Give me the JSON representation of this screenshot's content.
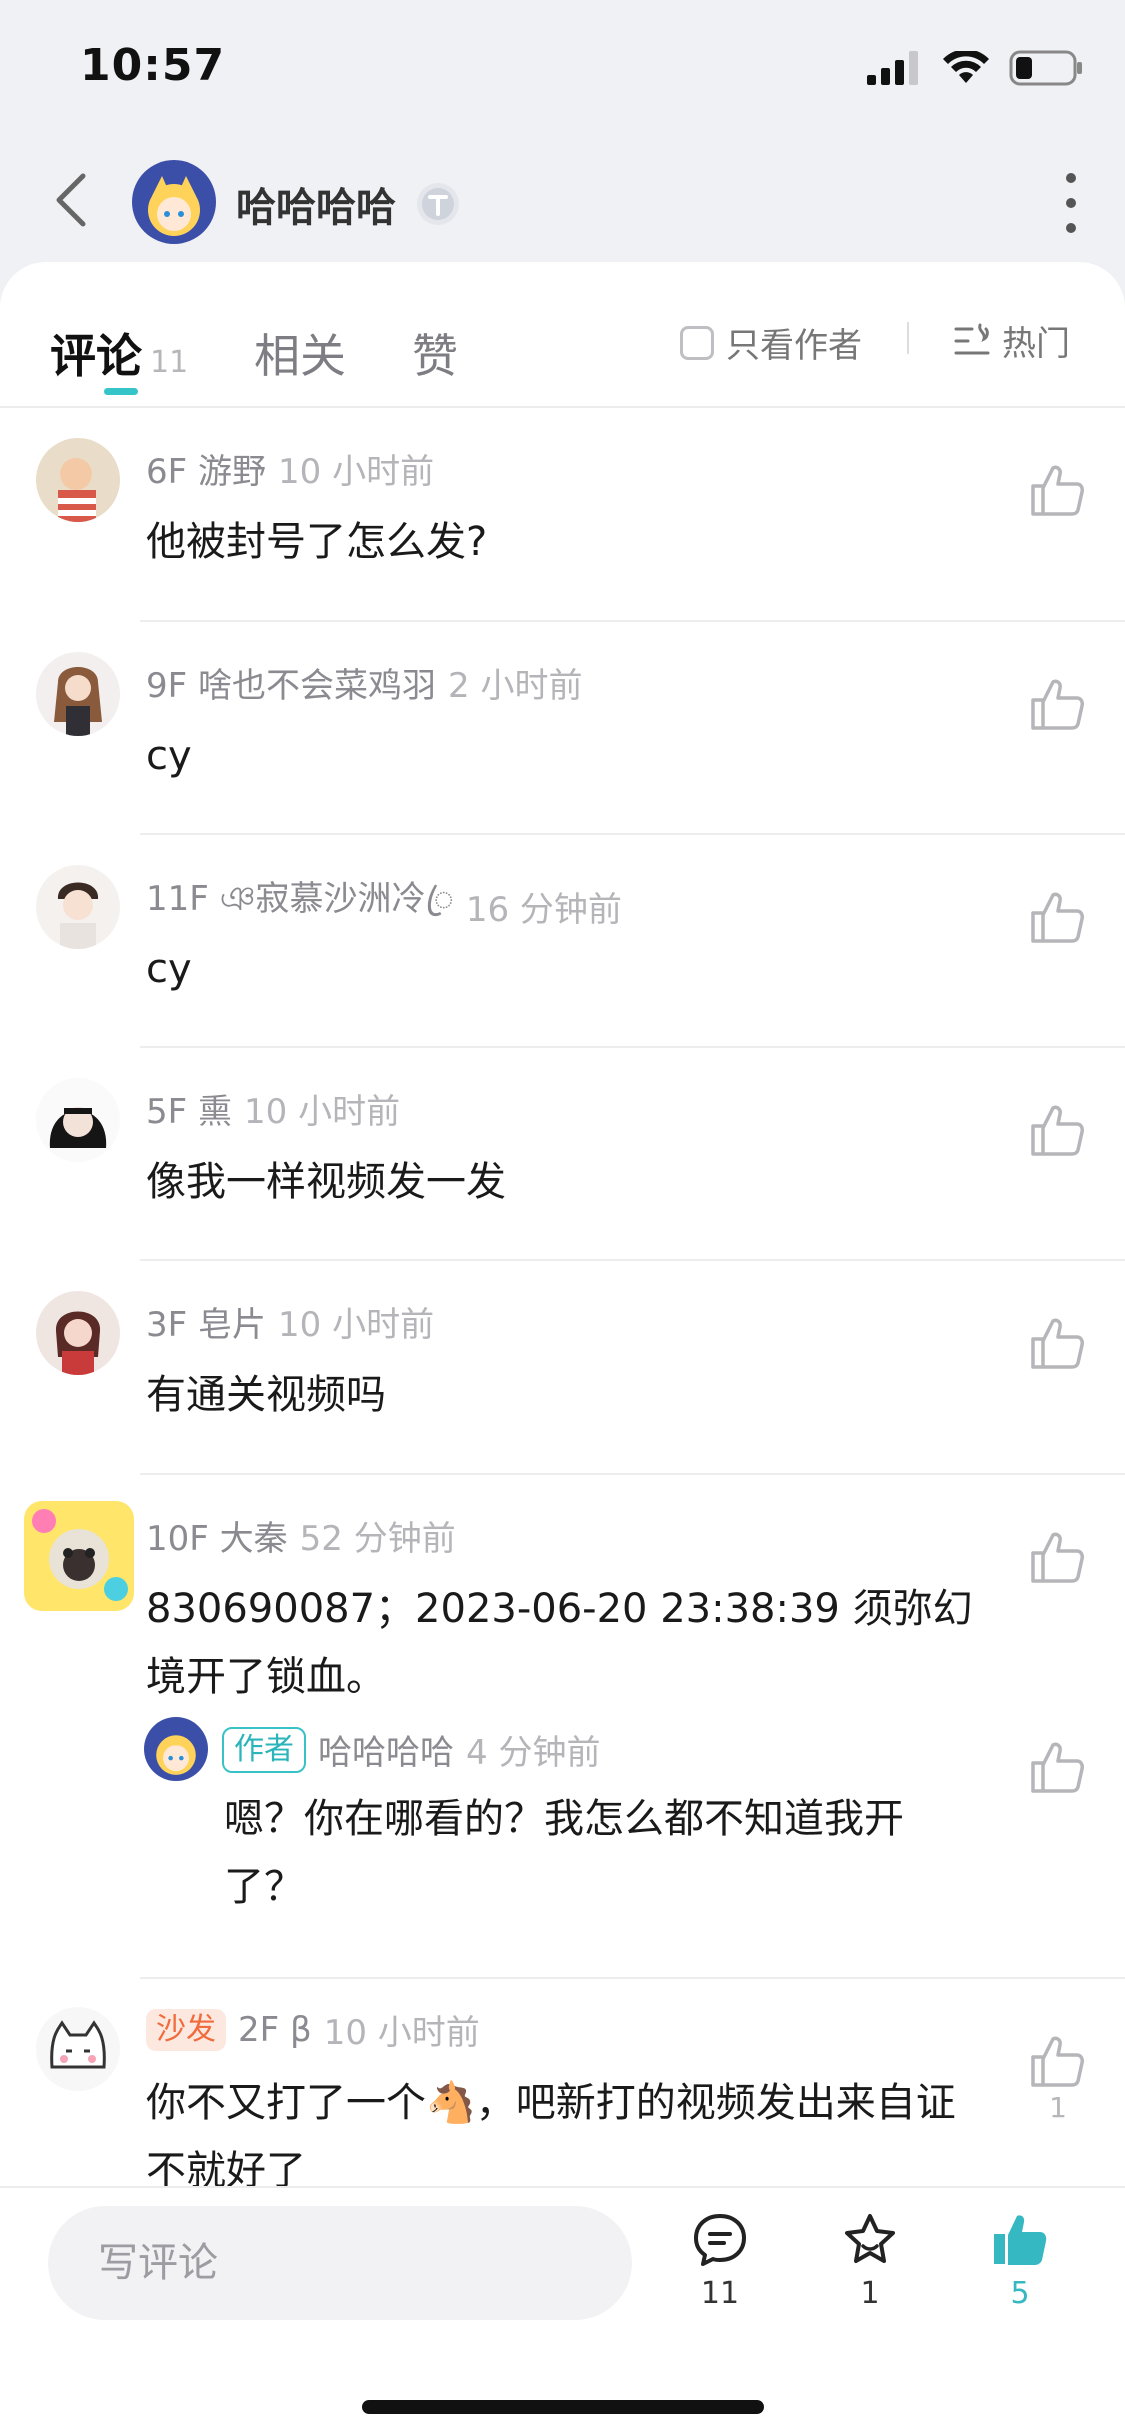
{
  "status_bar": {
    "time": "10:57"
  },
  "header": {
    "title": "哈哈哈哈"
  },
  "tabs": {
    "comments_label": "评论",
    "comments_count": "11",
    "related_label": "相关",
    "likes_label": "赞",
    "author_only_label": "只看作者",
    "sort_label": "热门"
  },
  "comments": [
    {
      "floor": "6F",
      "name": "游野",
      "time": "10 小时前",
      "text": "他被封号了怎么发?"
    },
    {
      "floor": "9F",
      "name": "啥也不会菜鸡羽",
      "time": "2 小时前",
      "text": "cy"
    },
    {
      "floor": "11F",
      "name": "ঞ寂慕沙洲冷ꦿ",
      "time": "16 分钟前",
      "text": "cy"
    },
    {
      "floor": "5F",
      "name": "熏",
      "time": "10 小时前",
      "text": "像我一样视频发一发"
    },
    {
      "floor": "3F",
      "name": "皂片",
      "time": "10 小时前",
      "text": "有通关视频吗"
    },
    {
      "floor": "10F",
      "name": "大秦",
      "time": "52 分钟前",
      "text": "830690087；2023-06-20 23:38:39  须弥幻境开了锁血。"
    },
    {
      "floor": "2F",
      "name": "β",
      "time": "10 小时前",
      "badge": "沙发",
      "text": "你不又打了一个🐴，吧新打的视频发出来自证不就好了",
      "likes": "1"
    }
  ],
  "reply": {
    "badge": "作者",
    "name": "哈哈哈哈",
    "time": "4 分钟前",
    "text": "嗯？你在哪看的？我怎么都不知道我开了？"
  },
  "bottom_bar": {
    "write_placeholder": "写评论",
    "comments_count": "11",
    "favorites_count": "1",
    "likes_count": "5"
  },
  "colors": {
    "accent": "#35c4c8",
    "like_active": "#35b8c2",
    "sofa": "#f06c3c"
  },
  "icons": [
    "back-arrow-icon",
    "more-icon",
    "level-badge-icon",
    "hot-sort-icon",
    "thumbs-up-icon",
    "comment-bubble-icon",
    "star-icon",
    "wifi-icon",
    "signal-icon",
    "battery-icon"
  ]
}
